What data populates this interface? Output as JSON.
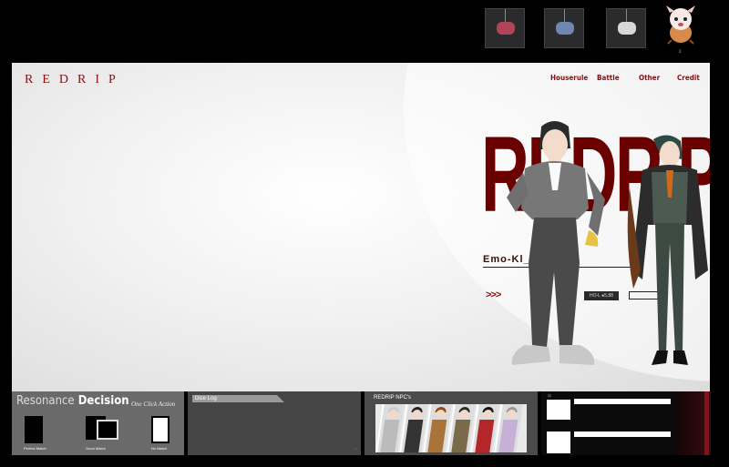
{
  "nav": {
    "logo": "REDRIP",
    "items": [
      "Houserule",
      "Battle",
      "Other",
      "Credit"
    ]
  },
  "hero": {
    "title": "REDRIP",
    "subtitle": "Emo-Kl___-TR",
    "arrows": ">>>",
    "hp": "HO-L ●5,88"
  },
  "panels": {
    "resonance": {
      "title_a": "Resonance",
      "title_b": "Decision",
      "one_click": "One Click Action",
      "options": [
        "Perfect Match",
        "Good Match",
        "No Match"
      ]
    },
    "dice_log": {
      "tab": "Dice Log",
      "dots": "▫ ▫"
    },
    "npcs": {
      "title": "REDRIP NPC's"
    },
    "right": {
      "label": "ﾛﾛ"
    }
  },
  "avatar_caption": "ﾛ",
  "colors": {
    "accent": "#8a0d13",
    "title_dark": "#6b0000"
  },
  "icons": [
    "charm-thumbnail",
    "charm-thumbnail",
    "charm-thumbnail",
    "avatar-dog-character"
  ]
}
